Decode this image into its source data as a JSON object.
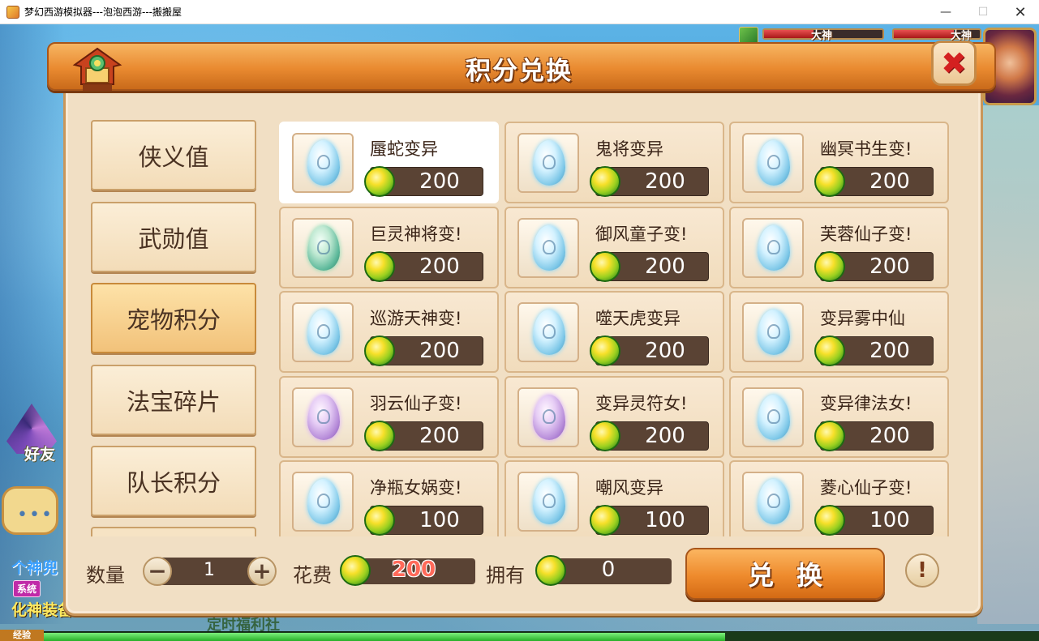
{
  "window": {
    "title": "梦幻西游模拟器---泡泡西游---搬搬屋",
    "min": "—",
    "max": "☐",
    "close": "✕"
  },
  "hud": {
    "player_label_1": "大神",
    "player_label_2": "大神"
  },
  "background_ui": {
    "friend_label": "好友",
    "chat_dots": "•••",
    "chat_line_1": "个神兜",
    "sys_badge": "系统",
    "chat_line_2": "化神装备",
    "exp_label": "经验",
    "behind_text": "定时福利社"
  },
  "dialog": {
    "title": "积分兑换",
    "close_icon": "✖"
  },
  "categories": [
    {
      "label": "侠义值",
      "active": false
    },
    {
      "label": "武勋值",
      "active": false
    },
    {
      "label": "宠物积分",
      "active": true
    },
    {
      "label": "法宝碎片",
      "active": false
    },
    {
      "label": "队长积分",
      "active": false
    }
  ],
  "items": [
    {
      "name": "蜃蛇变异",
      "price": "200",
      "egg": "blue",
      "selected": true
    },
    {
      "name": "鬼将变异",
      "price": "200",
      "egg": "blue",
      "selected": false
    },
    {
      "name": "幽冥书生变!",
      "price": "200",
      "egg": "blue",
      "selected": false
    },
    {
      "name": "巨灵神将变!",
      "price": "200",
      "egg": "green",
      "selected": false
    },
    {
      "name": "御风童子变!",
      "price": "200",
      "egg": "blue",
      "selected": false
    },
    {
      "name": "芙蓉仙子变!",
      "price": "200",
      "egg": "blue",
      "selected": false
    },
    {
      "name": "巡游天神变!",
      "price": "200",
      "egg": "blue",
      "selected": false
    },
    {
      "name": "噬天虎变异",
      "price": "200",
      "egg": "blue",
      "selected": false
    },
    {
      "name": "变异雾中仙",
      "price": "200",
      "egg": "blue",
      "selected": false
    },
    {
      "name": "羽云仙子变!",
      "price": "200",
      "egg": "purple",
      "selected": false
    },
    {
      "name": "变异灵符女!",
      "price": "200",
      "egg": "purple",
      "selected": false
    },
    {
      "name": "变异律法女!",
      "price": "200",
      "egg": "blue",
      "selected": false
    },
    {
      "name": "净瓶女娲变!",
      "price": "100",
      "egg": "blue",
      "selected": false
    },
    {
      "name": "嘲风变异",
      "price": "100",
      "egg": "blue",
      "selected": false
    },
    {
      "name": "菱心仙子变!",
      "price": "100",
      "egg": "blue",
      "selected": false
    }
  ],
  "bottom": {
    "quantity_label": "数量",
    "quantity_value": "1",
    "minus": "−",
    "plus": "+",
    "cost_label": "花费",
    "cost_value": "200",
    "own_label": "拥有",
    "own_value": "0",
    "exchange_label": "兑换",
    "help_icon": "!"
  },
  "colors": {
    "accent_orange": "#ee8a2c",
    "panel_bg": "#f1dfc4",
    "close_red": "#d42020",
    "cost_red": "#ff6a5a"
  }
}
